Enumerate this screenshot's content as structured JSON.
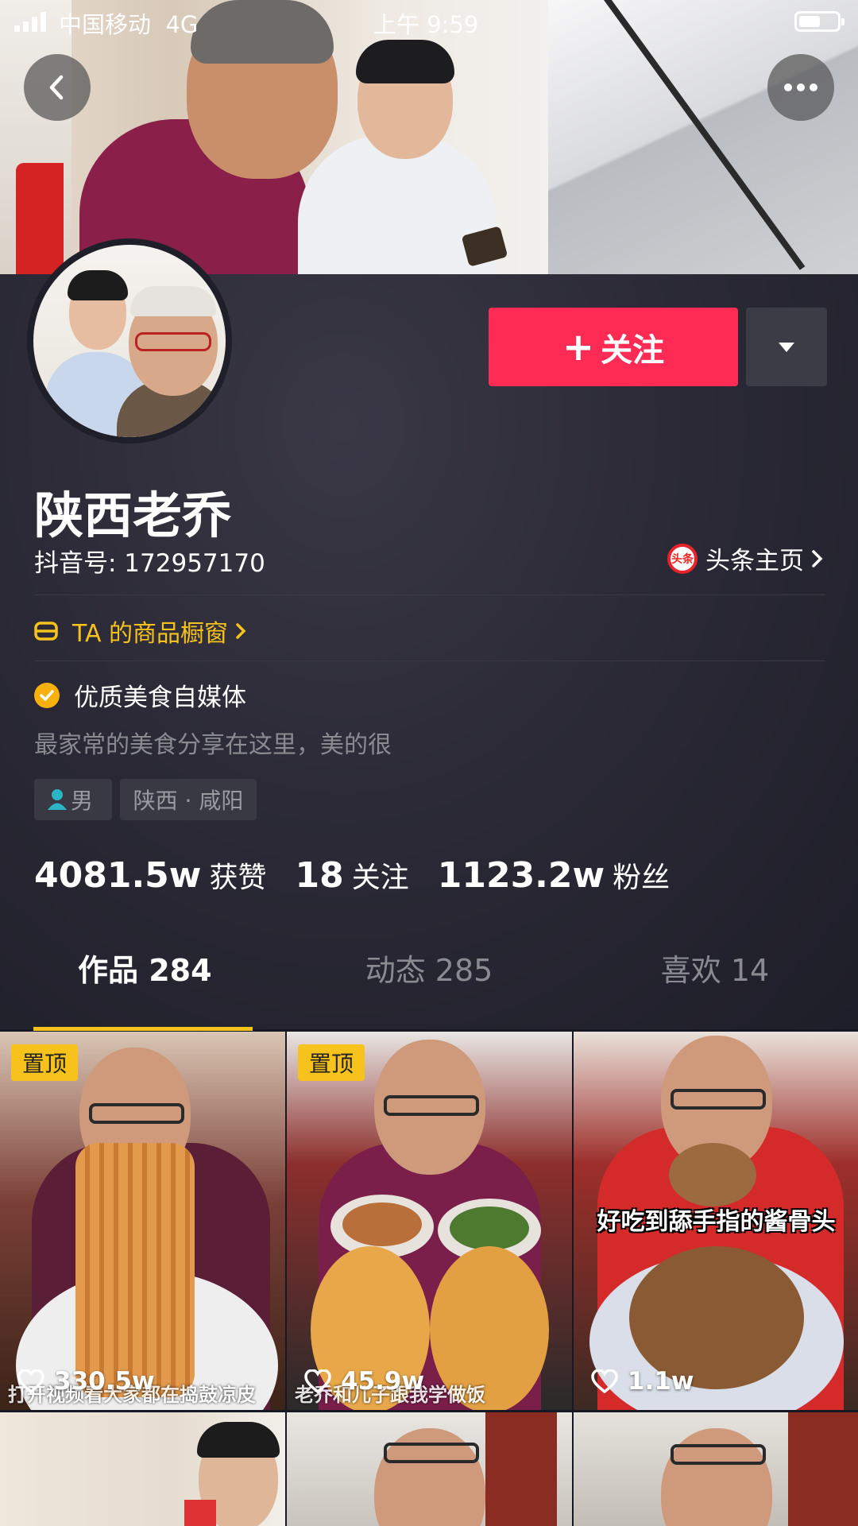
{
  "status_bar": {
    "carrier": "中国移动",
    "network": "4G",
    "time": "上午 9:59"
  },
  "profile": {
    "follow_label": "关注",
    "name": "陕西老乔",
    "douyin_id": "抖音号: 172957170",
    "toutiao_logo": "头条",
    "toutiao_label": "头条主页",
    "shop_label": "TA 的商品橱窗",
    "verified": "优质美食自媒体",
    "bio": "最家常的美食分享在这里，美的很",
    "gender": "男",
    "location": "陕西 · 咸阳",
    "stats": {
      "likes_value": "4081.5w",
      "likes_label": "获赞",
      "following_value": "18",
      "following_label": "关注",
      "fans_value": "1123.2w",
      "fans_label": "粉丝"
    }
  },
  "tabs": [
    {
      "label": "作品 284",
      "active": true
    },
    {
      "label": "动态 285",
      "active": false
    },
    {
      "label": "喜欢 14",
      "active": false
    }
  ],
  "videos": [
    {
      "pinned": "置顶",
      "likes": "330.5w",
      "caption": "打开视频看大家都在捣鼓凉皮"
    },
    {
      "pinned": "置顶",
      "likes": "45.9w",
      "caption": "老乔和儿子跟我学做饭"
    },
    {
      "pinned": "",
      "likes": "1.1w",
      "title": "好吃到舔手指的酱骨头"
    }
  ],
  "colors": {
    "accent": "#fe2c55",
    "highlight": "#f8c21d",
    "background": "#161823"
  },
  "icons": [
    "back-icon",
    "more-icon",
    "dropdown-icon",
    "shop-icon",
    "verified-icon",
    "person-icon",
    "heart-icon",
    "chevron-right-icon"
  ]
}
